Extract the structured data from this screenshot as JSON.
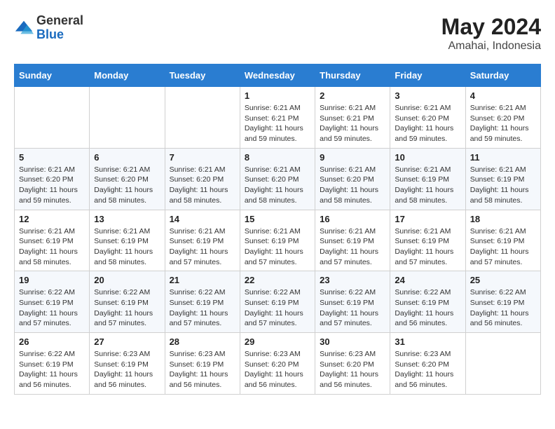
{
  "header": {
    "logo": {
      "general": "General",
      "blue": "Blue"
    },
    "title": "May 2024",
    "location": "Amahai, Indonesia"
  },
  "calendar": {
    "days_of_week": [
      "Sunday",
      "Monday",
      "Tuesday",
      "Wednesday",
      "Thursday",
      "Friday",
      "Saturday"
    ],
    "weeks": [
      [
        {
          "day": "",
          "info": ""
        },
        {
          "day": "",
          "info": ""
        },
        {
          "day": "",
          "info": ""
        },
        {
          "day": "1",
          "info": "Sunrise: 6:21 AM\nSunset: 6:21 PM\nDaylight: 11 hours and 59 minutes."
        },
        {
          "day": "2",
          "info": "Sunrise: 6:21 AM\nSunset: 6:21 PM\nDaylight: 11 hours and 59 minutes."
        },
        {
          "day": "3",
          "info": "Sunrise: 6:21 AM\nSunset: 6:20 PM\nDaylight: 11 hours and 59 minutes."
        },
        {
          "day": "4",
          "info": "Sunrise: 6:21 AM\nSunset: 6:20 PM\nDaylight: 11 hours and 59 minutes."
        }
      ],
      [
        {
          "day": "5",
          "info": "Sunrise: 6:21 AM\nSunset: 6:20 PM\nDaylight: 11 hours and 59 minutes."
        },
        {
          "day": "6",
          "info": "Sunrise: 6:21 AM\nSunset: 6:20 PM\nDaylight: 11 hours and 58 minutes."
        },
        {
          "day": "7",
          "info": "Sunrise: 6:21 AM\nSunset: 6:20 PM\nDaylight: 11 hours and 58 minutes."
        },
        {
          "day": "8",
          "info": "Sunrise: 6:21 AM\nSunset: 6:20 PM\nDaylight: 11 hours and 58 minutes."
        },
        {
          "day": "9",
          "info": "Sunrise: 6:21 AM\nSunset: 6:20 PM\nDaylight: 11 hours and 58 minutes."
        },
        {
          "day": "10",
          "info": "Sunrise: 6:21 AM\nSunset: 6:19 PM\nDaylight: 11 hours and 58 minutes."
        },
        {
          "day": "11",
          "info": "Sunrise: 6:21 AM\nSunset: 6:19 PM\nDaylight: 11 hours and 58 minutes."
        }
      ],
      [
        {
          "day": "12",
          "info": "Sunrise: 6:21 AM\nSunset: 6:19 PM\nDaylight: 11 hours and 58 minutes."
        },
        {
          "day": "13",
          "info": "Sunrise: 6:21 AM\nSunset: 6:19 PM\nDaylight: 11 hours and 58 minutes."
        },
        {
          "day": "14",
          "info": "Sunrise: 6:21 AM\nSunset: 6:19 PM\nDaylight: 11 hours and 57 minutes."
        },
        {
          "day": "15",
          "info": "Sunrise: 6:21 AM\nSunset: 6:19 PM\nDaylight: 11 hours and 57 minutes."
        },
        {
          "day": "16",
          "info": "Sunrise: 6:21 AM\nSunset: 6:19 PM\nDaylight: 11 hours and 57 minutes."
        },
        {
          "day": "17",
          "info": "Sunrise: 6:21 AM\nSunset: 6:19 PM\nDaylight: 11 hours and 57 minutes."
        },
        {
          "day": "18",
          "info": "Sunrise: 6:21 AM\nSunset: 6:19 PM\nDaylight: 11 hours and 57 minutes."
        }
      ],
      [
        {
          "day": "19",
          "info": "Sunrise: 6:22 AM\nSunset: 6:19 PM\nDaylight: 11 hours and 57 minutes."
        },
        {
          "day": "20",
          "info": "Sunrise: 6:22 AM\nSunset: 6:19 PM\nDaylight: 11 hours and 57 minutes."
        },
        {
          "day": "21",
          "info": "Sunrise: 6:22 AM\nSunset: 6:19 PM\nDaylight: 11 hours and 57 minutes."
        },
        {
          "day": "22",
          "info": "Sunrise: 6:22 AM\nSunset: 6:19 PM\nDaylight: 11 hours and 57 minutes."
        },
        {
          "day": "23",
          "info": "Sunrise: 6:22 AM\nSunset: 6:19 PM\nDaylight: 11 hours and 57 minutes."
        },
        {
          "day": "24",
          "info": "Sunrise: 6:22 AM\nSunset: 6:19 PM\nDaylight: 11 hours and 56 minutes."
        },
        {
          "day": "25",
          "info": "Sunrise: 6:22 AM\nSunset: 6:19 PM\nDaylight: 11 hours and 56 minutes."
        }
      ],
      [
        {
          "day": "26",
          "info": "Sunrise: 6:22 AM\nSunset: 6:19 PM\nDaylight: 11 hours and 56 minutes."
        },
        {
          "day": "27",
          "info": "Sunrise: 6:23 AM\nSunset: 6:19 PM\nDaylight: 11 hours and 56 minutes."
        },
        {
          "day": "28",
          "info": "Sunrise: 6:23 AM\nSunset: 6:19 PM\nDaylight: 11 hours and 56 minutes."
        },
        {
          "day": "29",
          "info": "Sunrise: 6:23 AM\nSunset: 6:20 PM\nDaylight: 11 hours and 56 minutes."
        },
        {
          "day": "30",
          "info": "Sunrise: 6:23 AM\nSunset: 6:20 PM\nDaylight: 11 hours and 56 minutes."
        },
        {
          "day": "31",
          "info": "Sunrise: 6:23 AM\nSunset: 6:20 PM\nDaylight: 11 hours and 56 minutes."
        },
        {
          "day": "",
          "info": ""
        }
      ]
    ]
  }
}
